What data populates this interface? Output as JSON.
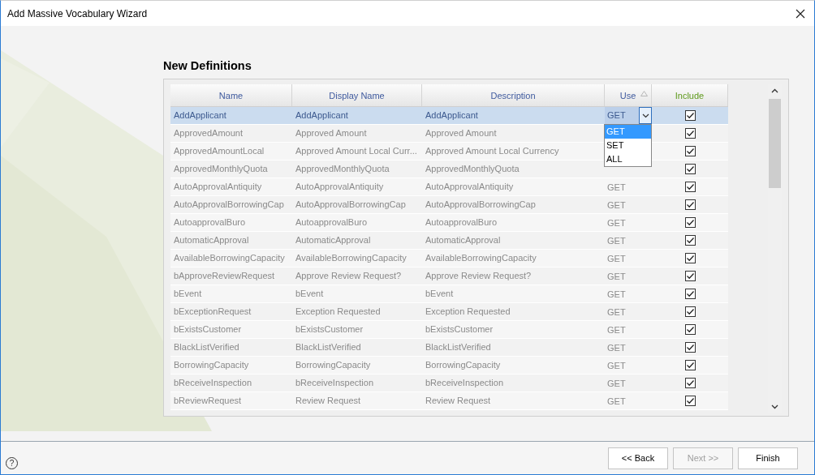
{
  "window": {
    "title": "Add Massive Vocabulary Wizard"
  },
  "heading": "New Definitions",
  "table": {
    "columns": [
      {
        "label": "Name",
        "kind": "text",
        "sorted": false
      },
      {
        "label": "Display Name",
        "kind": "text",
        "sorted": false
      },
      {
        "label": "Description",
        "kind": "text",
        "sorted": false
      },
      {
        "label": "Use",
        "kind": "text",
        "sorted": true
      },
      {
        "label": "Include",
        "kind": "checkbox",
        "sorted": false
      }
    ],
    "rows": [
      {
        "name": "AddApplicant",
        "display_name": "AddApplicant",
        "description": "AddApplicant",
        "use": "GET",
        "include": true,
        "selected": true,
        "open_dropdown": {
          "options": [
            {
              "label": "GET",
              "selected": true
            },
            {
              "label": "SET",
              "selected": false
            },
            {
              "label": "ALL",
              "selected": false
            }
          ]
        }
      },
      {
        "name": "ApprovedAmount",
        "display_name": "Approved Amount",
        "description": "Approved Amount",
        "include": true,
        "selected": false
      },
      {
        "name": "ApprovedAmountLocal",
        "display_name": "Approved Amount Local Curr...",
        "description": "Approved Amount Local Currency",
        "include": true,
        "selected": false
      },
      {
        "name": "ApprovedMonthlyQuota",
        "display_name": "ApprovedMonthlyQuota",
        "description": "ApprovedMonthlyQuota",
        "include": true,
        "selected": false
      },
      {
        "name": "AutoApprovalAntiquity",
        "display_name": "AutoApprovalAntiquity",
        "description": "AutoApprovalAntiquity",
        "use": "GET",
        "include": true,
        "selected": false
      },
      {
        "name": "AutoApprovalBorrowingCap",
        "display_name": "AutoApprovalBorrowingCap",
        "description": "AutoApprovalBorrowingCap",
        "use": "GET",
        "include": true,
        "selected": false
      },
      {
        "name": "AutoapprovalBuro",
        "display_name": "AutoapprovalBuro",
        "description": "AutoapprovalBuro",
        "use": "GET",
        "include": true,
        "selected": false
      },
      {
        "name": "AutomaticApproval",
        "display_name": "AutomaticApproval",
        "description": "AutomaticApproval",
        "use": "GET",
        "include": true,
        "selected": false
      },
      {
        "name": "AvailableBorrowingCapacity",
        "display_name": "AvailableBorrowingCapacity",
        "description": "AvailableBorrowingCapacity",
        "use": "GET",
        "include": true,
        "selected": false
      },
      {
        "name": "bApproveReviewRequest",
        "display_name": "Approve Review Request?",
        "description": "Approve Review Request?",
        "use": "GET",
        "include": true,
        "selected": false
      },
      {
        "name": "bEvent",
        "display_name": "bEvent",
        "description": "bEvent",
        "use": "GET",
        "include": true,
        "selected": false
      },
      {
        "name": "bExceptionRequest",
        "display_name": "Exception Requested",
        "description": "Exception Requested",
        "use": "GET",
        "include": true,
        "selected": false
      },
      {
        "name": "bExistsCustomer",
        "display_name": "bExistsCustomer",
        "description": "bExistsCustomer",
        "use": "GET",
        "include": true,
        "selected": false
      },
      {
        "name": "BlackListVerified",
        "display_name": "BlackListVerified",
        "description": "BlackListVerified",
        "use": "GET",
        "include": true,
        "selected": false
      },
      {
        "name": "BorrowingCapacity",
        "display_name": "BorrowingCapacity",
        "description": "BorrowingCapacity",
        "use": "GET",
        "include": true,
        "selected": false
      },
      {
        "name": "bReceiveInspection",
        "display_name": "bReceiveInspection",
        "description": "bReceiveInspection",
        "use": "GET",
        "include": true,
        "selected": false
      },
      {
        "name": "bReviewRequest",
        "display_name": "Review Request",
        "description": "Review Request",
        "use": "GET",
        "include": true,
        "selected": false
      }
    ]
  },
  "footer": {
    "help": "?",
    "buttons": [
      {
        "label": "<< Back",
        "disabled": false
      },
      {
        "label": "Next >>",
        "disabled": true
      },
      {
        "label": "Finish",
        "disabled": false
      }
    ]
  }
}
